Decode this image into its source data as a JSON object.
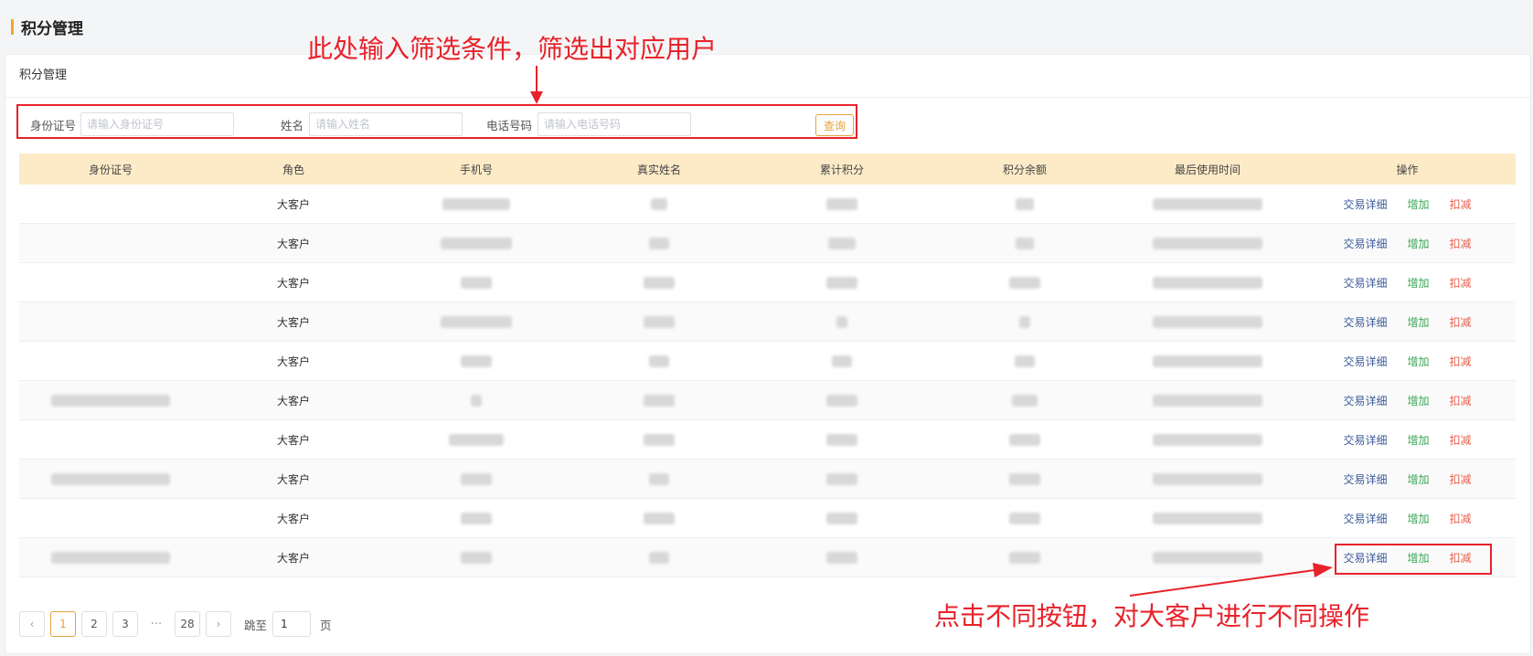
{
  "page": {
    "title": "积分管理"
  },
  "card": {
    "header": "积分管理"
  },
  "filters": {
    "id_label": "身份证号",
    "id_placeholder": "请输入身份证号",
    "name_label": "姓名",
    "name_placeholder": "请输入姓名",
    "phone_label": "电话号码",
    "phone_placeholder": "请输入电话号码",
    "query_label": "查询"
  },
  "table": {
    "columns": [
      "身份证号",
      "角色",
      "手机号",
      "真实姓名",
      "累计积分",
      "积分余额",
      "最后使用时间",
      "操作"
    ],
    "rows": [
      {
        "role": "大客户"
      },
      {
        "role": "大客户"
      },
      {
        "role": "大客户"
      },
      {
        "role": "大客户"
      },
      {
        "role": "大客户"
      },
      {
        "role": "大客户"
      },
      {
        "role": "大客户"
      },
      {
        "role": "大客户"
      },
      {
        "role": "大客户"
      },
      {
        "role": "大客户"
      }
    ],
    "actions": {
      "detail": "交易详细",
      "add": "增加",
      "deduct": "扣减"
    }
  },
  "pagination": {
    "prev": "‹",
    "next": "›",
    "pages": [
      "1",
      "2",
      "3"
    ],
    "ellipsis": "···",
    "last": "28",
    "jump_label": "跳至",
    "jump_value": "1",
    "page_label": "页"
  },
  "annotations": {
    "filter_note": "此处输入筛选条件，筛选出对应用户",
    "action_note": "点击不同按钮，对大客户进行不同操作"
  },
  "colors": {
    "accent": "#f5a623",
    "header_bg": "#fdebc8",
    "annotation": "#e8222a"
  }
}
